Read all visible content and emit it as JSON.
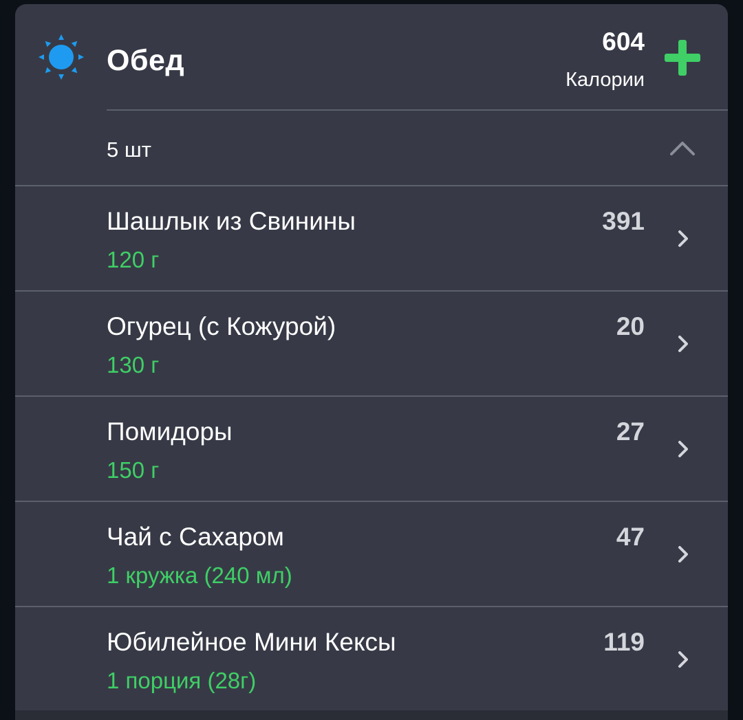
{
  "meal": {
    "title": "Обед",
    "icon": "sun-icon",
    "calories_total": "604",
    "calories_label": "Калории",
    "count_label": "5 шт",
    "accent_color": "#3fcf66",
    "sun_color": "#1e9bf0"
  },
  "items": [
    {
      "name": "Шашлык из Свинины",
      "portion": "120 г",
      "calories": "391"
    },
    {
      "name": "Огурец (с Кожурой)",
      "portion": "130 г",
      "calories": "20"
    },
    {
      "name": "Помидоры",
      "portion": "150 г",
      "calories": "27"
    },
    {
      "name": "Чай с Сахаром",
      "portion": "1 кружка (240 мл)",
      "calories": "47"
    },
    {
      "name": "Юбилейное Мини Кексы",
      "portion": "1 порция (28г)",
      "calories": "119"
    }
  ]
}
